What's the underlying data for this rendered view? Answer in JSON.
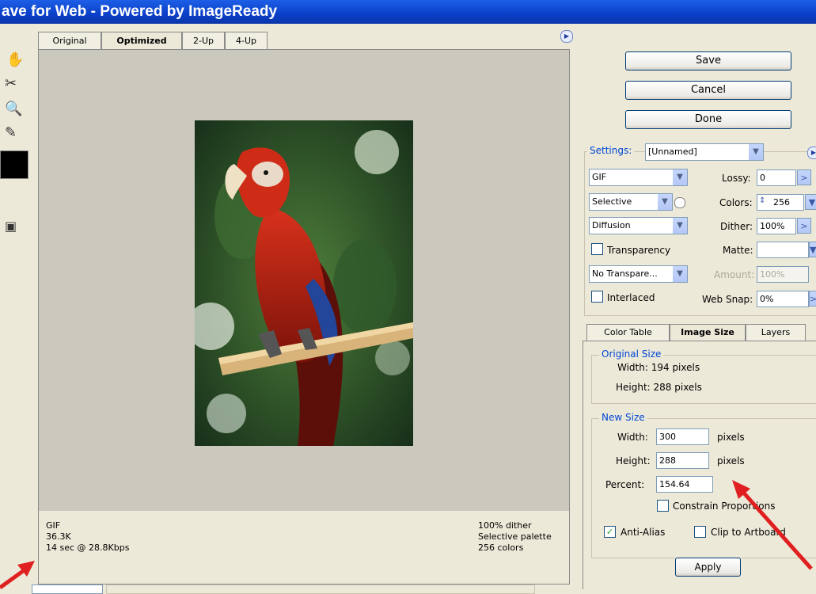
{
  "window": {
    "title": "ave for Web - Powered by ImageReady"
  },
  "view_tabs": [
    {
      "label": "Original",
      "active": false
    },
    {
      "label": "Optimized",
      "active": true
    },
    {
      "label": "2-Up",
      "active": false
    },
    {
      "label": "4-Up",
      "active": false
    }
  ],
  "tools": [
    "hand-icon",
    "slice-select-icon",
    "zoom-icon",
    "eyedropper-icon",
    "eyedropper-color-icon",
    "toggle-slices-icon"
  ],
  "info_left": {
    "format": "GIF",
    "size": "36.3K",
    "time": "14 sec @ 28.8Kbps"
  },
  "info_right": {
    "dither": "100% dither",
    "palette": "Selective palette",
    "colors": "256 colors"
  },
  "buttons": {
    "save": "Save",
    "cancel": "Cancel",
    "done": "Done",
    "apply": "Apply"
  },
  "settings": {
    "label": "Settings:",
    "preset": "[Unnamed]",
    "format": "GIF",
    "reduction": "Selective",
    "dither_algo": "Diffusion",
    "transparency_label": "Transparency",
    "transparency_checked": false,
    "transparency_dither": "No Transpare...",
    "interlaced_label": "Interlaced",
    "interlaced_checked": false,
    "lossy_label": "Lossy:",
    "lossy_value": "0",
    "colors_label": "Colors:",
    "colors_value": "256",
    "dither_label": "Dither:",
    "dither_value": "100%",
    "matte_label": "Matte:",
    "matte_value": "",
    "amount_label": "Amount:",
    "amount_value": "100%",
    "websnap_label": "Web Snap:",
    "websnap_value": "0%"
  },
  "panel_tabs": [
    {
      "label": "Color Table",
      "active": false
    },
    {
      "label": "Image Size",
      "active": true
    },
    {
      "label": "Layers",
      "active": false
    }
  ],
  "image_size": {
    "original_title": "Original Size",
    "original_width": "Width: 194 pixels",
    "original_height": "Height: 288 pixels",
    "new_title": "New Size",
    "width_label": "Width:",
    "width_value": "300",
    "height_label": "Height:",
    "height_value": "288",
    "percent_label": "Percent:",
    "percent_value": "154.64",
    "unit": "pixels",
    "constrain_label": "Constrain Proportions",
    "constrain_checked": false,
    "antialias_label": "Anti-Alias",
    "antialias_checked": true,
    "clip_label": "Clip to Artboard",
    "clip_checked": false
  },
  "colors": {
    "titlebar": "#0A3FC8",
    "dialog_bg": "#ECE9D8",
    "preview_bg": "#CBC8BD",
    "accent_blue": "#0046D5",
    "annotation_arrow": "#E02020"
  }
}
